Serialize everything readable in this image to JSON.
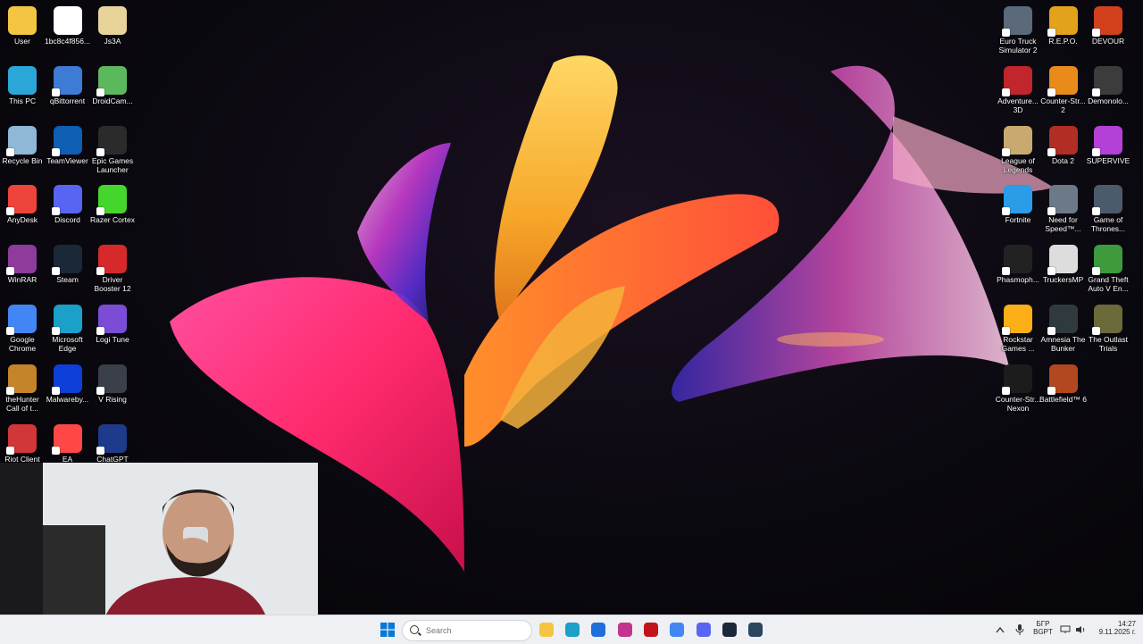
{
  "desktop": {
    "left_icons": [
      {
        "label": "User",
        "icon": "folder-icon",
        "color": "#f4c542"
      },
      {
        "label": "1bc8c4f856...",
        "icon": "file-icon",
        "color": "#ffffff"
      },
      {
        "label": "Js3A",
        "icon": "image-file-icon",
        "color": "#e8d39a"
      },
      {
        "label": "This PC",
        "icon": "monitor-icon",
        "color": "#2aa7d8"
      },
      {
        "label": "qBittorrent",
        "icon": "qbittorrent-icon",
        "color": "#3d7bd5"
      },
      {
        "label": "DroidCam...",
        "icon": "droidcam-icon",
        "color": "#5cb85c"
      },
      {
        "label": "Recycle Bin",
        "icon": "recycle-bin-icon",
        "color": "#8fb7d6"
      },
      {
        "label": "TeamViewer",
        "icon": "teamviewer-icon",
        "color": "#0e5fb4"
      },
      {
        "label": "Epic Games Launcher",
        "icon": "epic-games-icon",
        "color": "#2b2b2b"
      },
      {
        "label": "AnyDesk",
        "icon": "anydesk-icon",
        "color": "#ef443b"
      },
      {
        "label": "Discord",
        "icon": "discord-icon",
        "color": "#5865f2"
      },
      {
        "label": "Razer Cortex",
        "icon": "razer-cortex-icon",
        "color": "#44d62c"
      },
      {
        "label": "WinRAR",
        "icon": "winrar-icon",
        "color": "#8e3b9c"
      },
      {
        "label": "Steam",
        "icon": "steam-icon",
        "color": "#1b2838"
      },
      {
        "label": "Driver Booster 12",
        "icon": "driver-booster-icon",
        "color": "#d62a2a"
      },
      {
        "label": "Google Chrome",
        "icon": "chrome-icon",
        "color": "#4285f4"
      },
      {
        "label": "Microsoft Edge",
        "icon": "edge-icon",
        "color": "#1aa0c9"
      },
      {
        "label": "Logi Tune",
        "icon": "logi-tune-icon",
        "color": "#7b4dd6"
      },
      {
        "label": "theHunter Call of t...",
        "icon": "thehunter-icon",
        "color": "#c4842a"
      },
      {
        "label": "Malwareby...",
        "icon": "malwarebytes-icon",
        "color": "#0d3ed7"
      },
      {
        "label": "V Rising",
        "icon": "v-rising-icon",
        "color": "#3b3f4a"
      },
      {
        "label": "Riot Client",
        "icon": "riot-client-icon",
        "color": "#d13639"
      },
      {
        "label": "EA",
        "icon": "ea-icon",
        "color": "#ff4747"
      },
      {
        "label": "ChatGPT",
        "icon": "chatgpt-icon",
        "color": "#1e3a8a"
      }
    ],
    "right_icons": [
      {
        "label": "Euro Truck Simulator 2",
        "icon": "euro-truck-icon",
        "color": "#5a6a7a"
      },
      {
        "label": "R.E.P.O.",
        "icon": "repo-icon",
        "color": "#e2a21c"
      },
      {
        "label": "DEVOUR",
        "icon": "devour-icon",
        "color": "#d2401e"
      },
      {
        "label": "Adventure... 3D",
        "icon": "adventure-3d-icon",
        "color": "#c0262b"
      },
      {
        "label": "Counter-Str... 2",
        "icon": "counter-strike-2-icon",
        "color": "#e98b1b"
      },
      {
        "label": "Demonolo...",
        "icon": "demonologist-icon",
        "color": "#3c3c3c"
      },
      {
        "label": "League of Legends",
        "icon": "league-of-legends-icon",
        "color": "#c8aa6e"
      },
      {
        "label": "Dota 2",
        "icon": "dota-2-icon",
        "color": "#b22d24"
      },
      {
        "label": "SUPERVIVE",
        "icon": "supervive-icon",
        "color": "#b540d8"
      },
      {
        "label": "Fortnite",
        "icon": "fortnite-icon",
        "color": "#2a9ce8"
      },
      {
        "label": "Need for Speed™...",
        "icon": "need-for-speed-icon",
        "color": "#6c7a87"
      },
      {
        "label": "Game of Thrones...",
        "icon": "game-of-thrones-icon",
        "color": "#4b5b6b"
      },
      {
        "label": "Phasmoph...",
        "icon": "phasmophobia-icon",
        "color": "#222222"
      },
      {
        "label": "TruckersMP",
        "icon": "truckersmp-icon",
        "color": "#dddddd"
      },
      {
        "label": "Grand Theft Auto V En...",
        "icon": "gta-v-icon",
        "color": "#3d9a3d"
      },
      {
        "label": "Rockstar Games ...",
        "icon": "rockstar-games-icon",
        "color": "#fcaf17"
      },
      {
        "label": "Amnesia The Bunker",
        "icon": "amnesia-bunker-icon",
        "color": "#2f3a3f"
      },
      {
        "label": "The Outlast Trials",
        "icon": "outlast-trials-icon",
        "color": "#6a6a3a"
      },
      {
        "label": "Counter-Str... Nexon",
        "icon": "csn-icon",
        "color": "#1c1c1c"
      },
      {
        "label": "Battlefield™ 6",
        "icon": "battlefield-6-icon",
        "color": "#b3471f"
      }
    ]
  },
  "taskbar": {
    "search_placeholder": "Search",
    "pinned": [
      {
        "name": "file-explorer-icon",
        "color": "#f4c542"
      },
      {
        "name": "edge-icon",
        "color": "#1aa0c9"
      },
      {
        "name": "store-icon",
        "color": "#1e6fd9"
      },
      {
        "name": "instagram-icon",
        "color": "#c1358f"
      },
      {
        "name": "opera-icon",
        "color": "#c0161b"
      },
      {
        "name": "chrome-icon",
        "color": "#4285f4"
      },
      {
        "name": "discord-icon",
        "color": "#5865f2"
      },
      {
        "name": "steam-icon",
        "color": "#1b2838"
      },
      {
        "name": "steam-icon",
        "color": "#2a475e"
      }
    ],
    "tray": {
      "language_top": "БГР",
      "language_bottom": "BGPT",
      "time": "14:27",
      "date": "9.11.2025 г."
    }
  }
}
